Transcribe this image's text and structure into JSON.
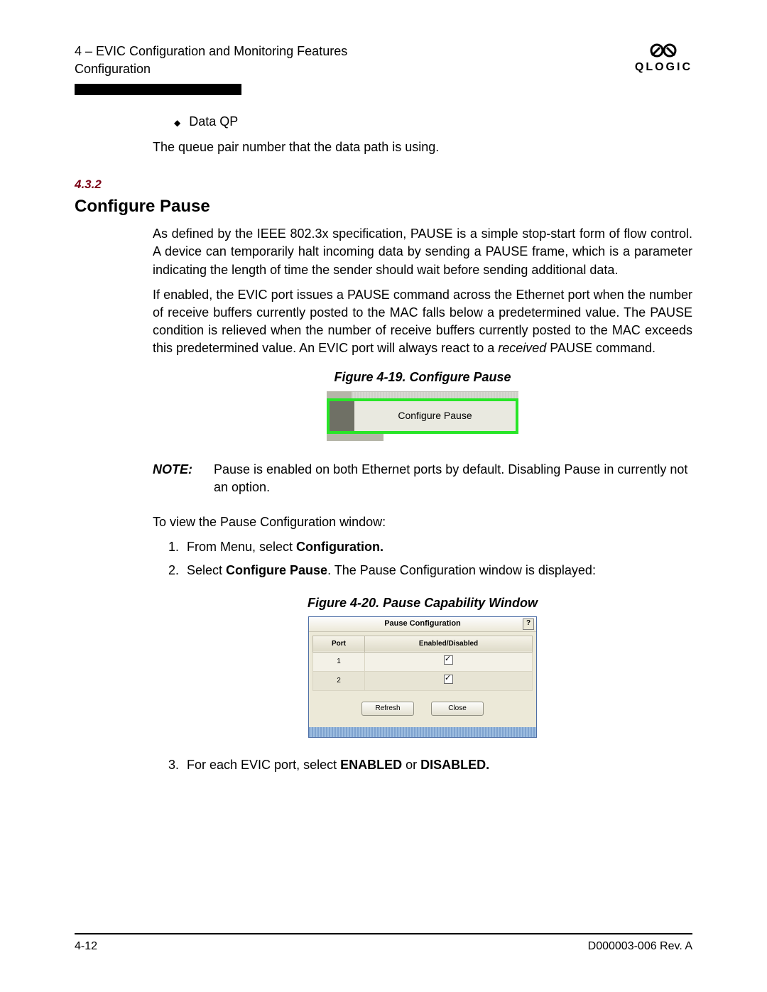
{
  "header": {
    "line1": "4 – EVIC Configuration and Monitoring Features",
    "line2": "Configuration",
    "logo_text": "QLOGIC"
  },
  "bullet": {
    "title": "Data QP",
    "desc": "The queue pair number that the data path is using."
  },
  "section": {
    "number": "4.3.2",
    "title": "Configure Pause",
    "para1": "As defined by the IEEE 802.3x specification, PAUSE is a simple stop-start form of flow control. A device can temporarily halt incoming data by sending a PAUSE frame, which is a parameter indicating the length of time the sender should wait before sending additional data.",
    "para2_a": "If enabled, the EVIC port issues a PAUSE command across the Ethernet port when the number of receive buffers currently posted to the MAC falls below a predetermined value. The PAUSE condition is relieved when the number of receive buffers currently posted to the MAC exceeds this predetermined value. An EVIC port will always react to a ",
    "para2_em": "received",
    "para2_b": " PAUSE command."
  },
  "fig19": {
    "caption": "Figure 4-19. Configure Pause",
    "label": "Configure Pause"
  },
  "note": {
    "label": "NOTE:",
    "text": "Pause is enabled on both Ethernet ports by default. Disabling Pause in currently not an option."
  },
  "instructions": {
    "lead": "To view the Pause Configuration window:",
    "items": [
      {
        "n": "1.",
        "pre": "From Menu, select ",
        "bold": "Configuration.",
        "post": ""
      },
      {
        "n": "2.",
        "pre": "Select ",
        "bold": "Configure Pause",
        "post": ". The Pause Configuration window is displayed:"
      }
    ]
  },
  "fig20": {
    "caption": "Figure 4-20. Pause Capability Window",
    "title": "Pause Configuration",
    "help": "?",
    "col1": "Port",
    "col2": "Enabled/Disabled",
    "rows": [
      {
        "port": "1",
        "checked": true
      },
      {
        "port": "2",
        "checked": true
      }
    ],
    "refresh": "Refresh",
    "close": "Close"
  },
  "item3": {
    "n": "3.",
    "pre": "For each EVIC port, select ",
    "b1": "ENABLED",
    "mid": " or ",
    "b2": "DISABLED.",
    "post": ""
  },
  "footer": {
    "left": "4-12",
    "right": "D000003-006 Rev. A"
  }
}
